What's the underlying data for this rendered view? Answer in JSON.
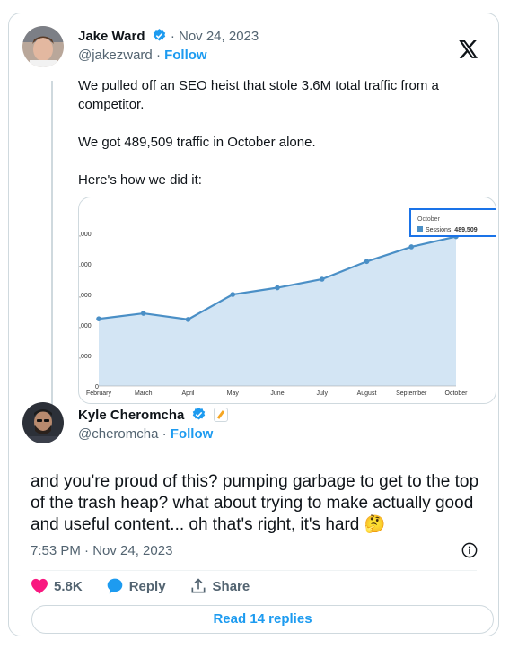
{
  "tweet": {
    "author_name": "Jake Ward",
    "author_handle": "@jakezward",
    "date": "Nov 24, 2023",
    "follow_label": "Follow",
    "separator": "·",
    "text_lines": [
      "We pulled off an SEO heist that stole 3.6M total traffic from a competitor.",
      "We got 489,509 traffic in October alone.",
      "Here's how we did it:"
    ]
  },
  "chart_data": {
    "type": "area",
    "categories": [
      "February",
      "March",
      "April",
      "May",
      "June",
      "July",
      "August",
      "September",
      "October"
    ],
    "series": [
      {
        "name": "Sessions",
        "values": [
          220000,
          238000,
          218000,
          300000,
          322000,
          350000,
          408000,
          456000,
          489509
        ]
      }
    ],
    "y_tick_labels": [
      "0",
      ",000",
      ",000",
      ",000",
      ",000",
      ",000"
    ],
    "ylim": [
      0,
      500000
    ],
    "tooltip": {
      "title": "October",
      "label": "Sessions:",
      "value": "489,509"
    },
    "colors": {
      "line": "#4a8fc6",
      "fill": "#d3e5f4",
      "tooltip_border": "#1a73e8"
    }
  },
  "reply": {
    "author_name": "Kyle Cheromcha",
    "author_handle": "@cheromcha",
    "follow_label": "Follow",
    "separator": "·",
    "text": "and you're proud of this? pumping garbage to get to the top of the trash heap? what about trying to make actually good and useful content... oh that's right, it's hard",
    "emoji": "🤔",
    "time": "7:53 PM · Nov 24, 2023"
  },
  "actions": {
    "like_count": "5.8K",
    "reply_label": "Reply",
    "share_label": "Share"
  },
  "read_replies_label": "Read 14 replies",
  "icons": {
    "verified": "verified-badge-icon",
    "x_logo": "x-logo-icon",
    "like": "heart-icon",
    "reply": "speech-bubble-icon",
    "share": "share-icon",
    "info": "info-icon"
  },
  "colors": {
    "accent": "#1d9bf0",
    "like": "#f91880",
    "muted": "#536471"
  }
}
